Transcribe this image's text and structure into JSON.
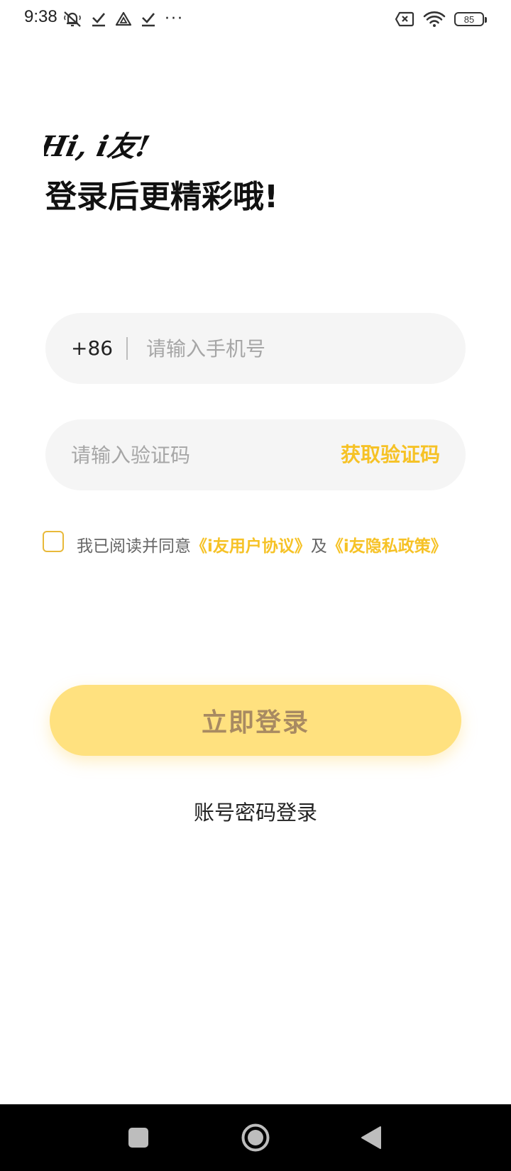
{
  "status_bar": {
    "time": "9:38",
    "battery": "85"
  },
  "greeting": {
    "logo_text": "Hi, i友!",
    "title": "登录后更精彩哦!"
  },
  "phone_field": {
    "country_code": "+86",
    "placeholder": "请输入手机号"
  },
  "code_field": {
    "placeholder": "请输入验证码",
    "get_code_label": "获取验证码"
  },
  "agreement": {
    "prefix": "我已阅读并同意",
    "user_agreement": "《i友用户协议》",
    "conjunction": "及",
    "privacy_policy": "《i友隐私政策》"
  },
  "login_button": {
    "label": "立即登录"
  },
  "password_login": {
    "label": "账号密码登录"
  },
  "colors": {
    "accent": "#f6c226",
    "button_bg": "#ffe17f",
    "button_text": "#a88a62",
    "field_bg": "#f5f5f5",
    "nav_bar": "#000000"
  }
}
